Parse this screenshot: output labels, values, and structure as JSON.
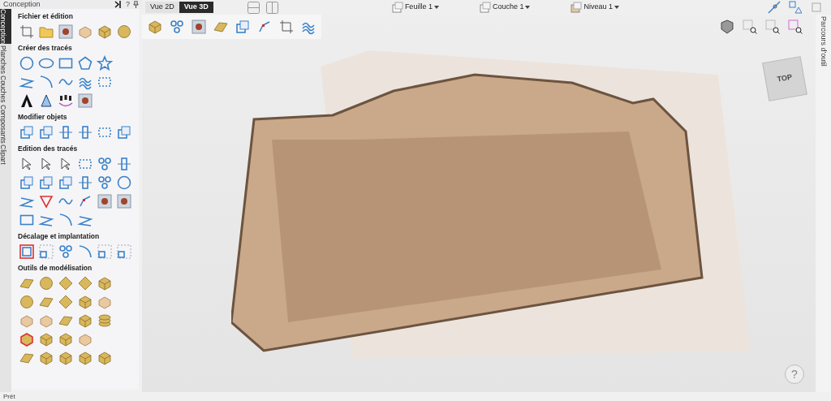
{
  "panel": {
    "title": "Conception",
    "help": "?"
  },
  "side_tabs": [
    {
      "label": "Conception",
      "selected": true
    },
    {
      "label": "Planches",
      "selected": false
    },
    {
      "label": "Couches",
      "selected": false
    },
    {
      "label": "Composants",
      "selected": false
    },
    {
      "label": "Clipart",
      "selected": false
    }
  ],
  "sections": [
    {
      "title": "Fichier et édition"
    },
    {
      "title": "Créer des tracés"
    },
    {
      "title": "Modifier objets"
    },
    {
      "title": "Edition des tracés"
    },
    {
      "title": "Décalage et implantation"
    },
    {
      "title": "Outils de modélisation"
    }
  ],
  "view_tabs": [
    {
      "label": "Vue 2D",
      "selected": false
    },
    {
      "label": "Vue 3D",
      "selected": true
    }
  ],
  "dropdowns": [
    "Feuille 1",
    "Couche 1",
    "Niveau 1"
  ],
  "view_cube": {
    "label": "TOP"
  },
  "help_button": "?",
  "right_tab": {
    "label": "Parcours d'outil"
  },
  "status_bar": "Prêt"
}
